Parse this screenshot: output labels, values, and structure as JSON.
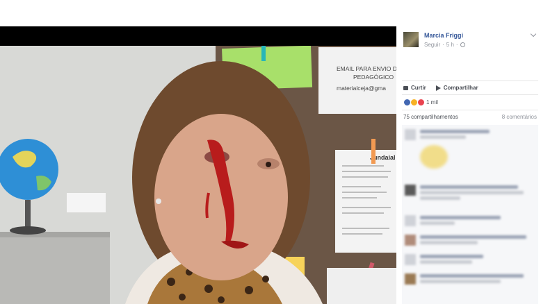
{
  "post": {
    "photo_panel": {
      "email_notice_line1": "EMAIL PARA ENVIO DE",
      "email_notice_line2": "PEDAGÓGICO",
      "email_notice_line3": "materialceja@gma",
      "sign_text": "Jundaial"
    },
    "author": {
      "name": "Marcia Friggi",
      "follow_label": "Seguir",
      "time": "5 h"
    },
    "actions": {
      "like_label": "Curtir",
      "share_label": "Compartilhar"
    },
    "reactions": {
      "count": "1 mil",
      "colors": [
        "#4267b2",
        "#f7b125",
        "#e9434f"
      ]
    },
    "stats": {
      "shares": "75 compartilhamentos",
      "comments": "8 comentários"
    }
  }
}
